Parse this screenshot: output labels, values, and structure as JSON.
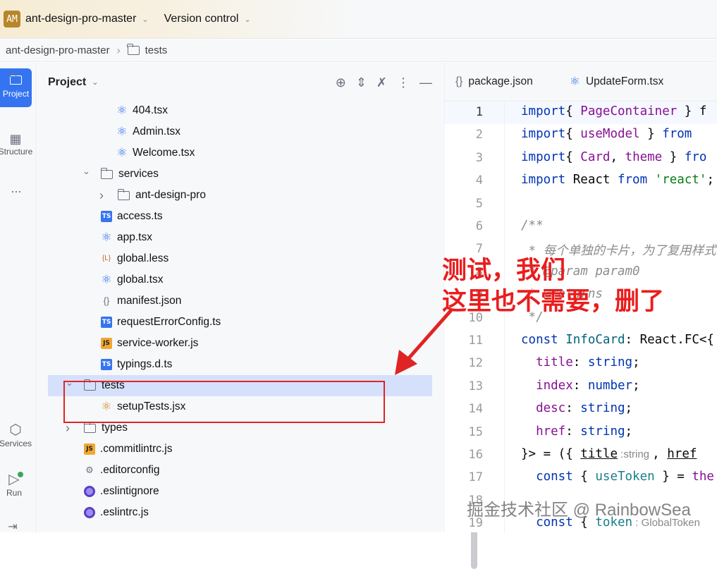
{
  "titlebar": {
    "project_badge": "AM",
    "project_name": "ant-design-pro-master",
    "vcs": "Version control"
  },
  "breadcrumb": {
    "root": "ant-design-pro-master",
    "current": "tests"
  },
  "leftbar": {
    "project": "Project",
    "structure": "Structure",
    "more": "...",
    "services": "Services",
    "run": "Run"
  },
  "panel": {
    "title": "Project"
  },
  "tree": [
    {
      "label": "404.tsx",
      "icon": "react"
    },
    {
      "label": "Admin.tsx",
      "icon": "react"
    },
    {
      "label": "Welcome.tsx",
      "icon": "react"
    },
    {
      "label": "services",
      "icon": "folder",
      "expanded": true
    },
    {
      "label": "ant-design-pro",
      "icon": "folder",
      "expanded": false
    },
    {
      "label": "access.ts",
      "icon": "ts"
    },
    {
      "label": "app.tsx",
      "icon": "react"
    },
    {
      "label": "global.less",
      "icon": "less"
    },
    {
      "label": "global.tsx",
      "icon": "react"
    },
    {
      "label": "manifest.json",
      "icon": "json"
    },
    {
      "label": "requestErrorConfig.ts",
      "icon": "ts"
    },
    {
      "label": "service-worker.js",
      "icon": "js"
    },
    {
      "label": "typings.d.ts",
      "icon": "ts"
    },
    {
      "label": "tests",
      "icon": "folder",
      "expanded": true,
      "selected": true
    },
    {
      "label": "setupTests.jsx",
      "icon": "react-jsx"
    },
    {
      "label": "types",
      "icon": "folder",
      "expanded": false
    },
    {
      "label": ".commitlintrc.js",
      "icon": "js"
    },
    {
      "label": ".editorconfig",
      "icon": "gear"
    },
    {
      "label": ".eslintignore",
      "icon": "eslint"
    },
    {
      "label": ".eslintrc.js",
      "icon": "eslint"
    }
  ],
  "editor": {
    "tabs": [
      "package.json",
      "UpdateForm.tsx"
    ],
    "line_numbers": [
      "1",
      "2",
      "3",
      "4",
      "5",
      "6",
      "7",
      "8",
      "9",
      "10",
      "11",
      "12",
      "13",
      "14",
      "15",
      "16",
      "17",
      "18",
      "19"
    ],
    "lines": [
      [
        [
          "kw",
          "import"
        ],
        [
          "",
          "{ "
        ],
        [
          "id",
          "PageContainer"
        ],
        [
          "",
          " } f"
        ]
      ],
      [
        [
          "kw",
          "import"
        ],
        [
          "",
          "{ "
        ],
        [
          "id",
          "useModel"
        ],
        [
          "",
          " } "
        ],
        [
          "kw",
          "from"
        ]
      ],
      [
        [
          "kw",
          "import"
        ],
        [
          "",
          "{ "
        ],
        [
          "id",
          "Card"
        ],
        [
          "",
          ", "
        ],
        [
          "id",
          "theme"
        ],
        [
          "",
          " } "
        ],
        [
          "kw",
          "fro"
        ]
      ],
      [
        [
          "kw",
          "import"
        ],
        [
          "",
          " React "
        ],
        [
          "kw",
          "from"
        ],
        [
          "",
          " "
        ],
        [
          "str",
          "'react'"
        ],
        [
          "",
          ";"
        ]
      ],
      [],
      [
        [
          "cm",
          "/**"
        ]
      ],
      [
        [
          "cm",
          " * 每个单独的卡片，为了复用样式"
        ]
      ],
      [
        [
          "cm",
          " * @param "
        ],
        [
          "cm",
          "param0"
        ]
      ],
      [
        [
          "cm",
          " * @returns"
        ]
      ],
      [
        [
          "cm",
          " */"
        ]
      ],
      [
        [
          "kw",
          "const"
        ],
        [
          "",
          " "
        ],
        [
          "ty",
          "InfoCard"
        ],
        [
          "",
          ": React.FC<{"
        ]
      ],
      [
        [
          "id",
          "  title"
        ],
        [
          "",
          ": "
        ],
        [
          "kw",
          "string"
        ],
        [
          "",
          ";"
        ]
      ],
      [
        [
          "id",
          "  index"
        ],
        [
          "",
          ": "
        ],
        [
          "kw",
          "number"
        ],
        [
          "",
          ";"
        ]
      ],
      [
        [
          "id",
          "  desc"
        ],
        [
          "",
          ": "
        ],
        [
          "kw",
          "string"
        ],
        [
          "",
          ";"
        ]
      ],
      [
        [
          "id",
          "  href"
        ],
        [
          "",
          ": "
        ],
        [
          "kw",
          "string"
        ],
        [
          "",
          ";"
        ]
      ],
      [
        [
          "",
          "}> = ({ "
        ],
        [
          "u",
          "title"
        ],
        [
          "hint",
          " :string "
        ],
        [
          "",
          ", "
        ],
        [
          "u",
          "href"
        ]
      ],
      [
        [
          "kw",
          "  const"
        ],
        [
          "",
          " { "
        ],
        [
          "tk",
          "useToken"
        ],
        [
          "",
          " } = "
        ],
        [
          "id",
          "the"
        ]
      ],
      [],
      [
        [
          "kw",
          "  const"
        ],
        [
          "",
          " { "
        ],
        [
          "tk",
          "token"
        ],
        [
          "hint",
          " : GlobalToken"
        ]
      ]
    ]
  },
  "annotation": {
    "line1": "测试，我们",
    "line2": "这里也不需要，删了"
  },
  "watermark": "掘金技术社区 @ RainbowSea"
}
